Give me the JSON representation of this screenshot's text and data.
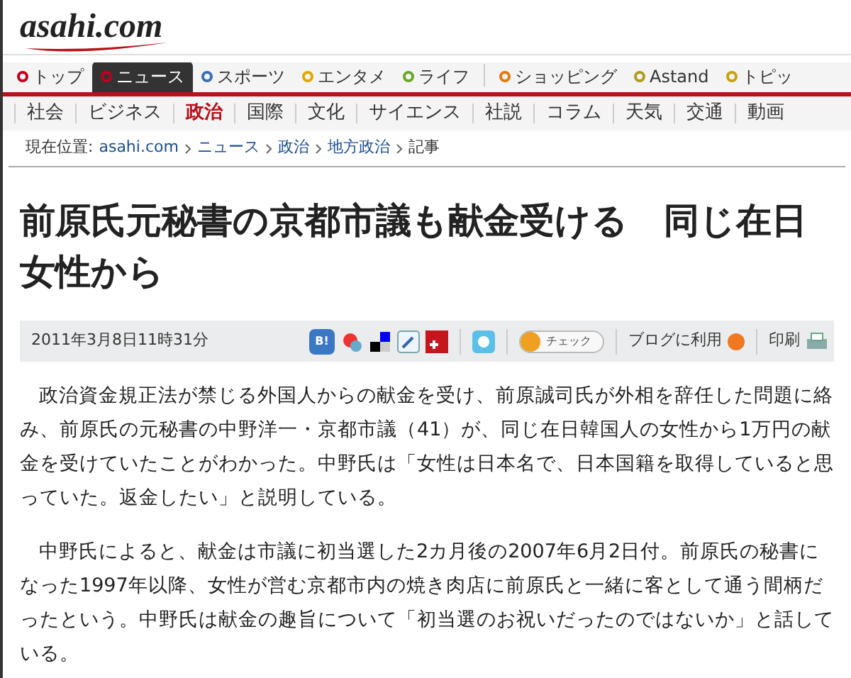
{
  "logo": "asahi.com",
  "top_nav": [
    {
      "label": "トップ",
      "color": "#c0001a",
      "selected": false
    },
    {
      "label": "ニュース",
      "color": "#c0001a",
      "selected": true
    },
    {
      "label": "スポーツ",
      "color": "#3a6fb0",
      "selected": false
    },
    {
      "label": "エンタメ",
      "color": "#e0a800",
      "selected": false
    },
    {
      "label": "ライフ",
      "color": "#6aa82a",
      "selected": false
    },
    {
      "label": "ショッピング",
      "color": "#e07a10",
      "selected": false
    },
    {
      "label": "Astand",
      "color": "#b09a20",
      "selected": false
    },
    {
      "label": "トピッ",
      "color": "#c8a010",
      "selected": false
    }
  ],
  "sub_nav": [
    {
      "label": "社会",
      "selected": false
    },
    {
      "label": "ビジネス",
      "selected": false
    },
    {
      "label": "政治",
      "selected": true
    },
    {
      "label": "国際",
      "selected": false
    },
    {
      "label": "文化",
      "selected": false
    },
    {
      "label": "サイエンス",
      "selected": false
    },
    {
      "label": "社説",
      "selected": false
    },
    {
      "label": "コラム",
      "selected": false
    },
    {
      "label": "天気",
      "selected": false
    },
    {
      "label": "交通",
      "selected": false
    },
    {
      "label": "動画",
      "selected": false
    }
  ],
  "breadcrumb": {
    "label": "現在位置:",
    "links": [
      "asahi.com",
      "ニュース",
      "政治",
      "地方政治"
    ],
    "current": "記事"
  },
  "headline": "前原氏元秘書の京都市議も献金受ける　同じ在日女性から",
  "toolbar": {
    "date": "2011年3月8日11時31分",
    "bookmark": "B!",
    "check": "チェック",
    "blog": "ブログに利用",
    "print": "印刷"
  },
  "paragraphs": [
    "政治資金規正法が禁じる外国人からの献金を受け、前原誠司氏が外相を辞任した問題に絡み、前原氏の元秘書の中野洋一・京都市議（41）が、同じ在日韓国人の女性から1万円の献金を受けていたことがわかった。中野氏は「女性は日本名で、日本国籍を取得していると思っていた。返金したい」と説明している。",
    "中野氏によると、献金は市議に初当選した2カ月後の2007年6月2日付。前原氏の秘書になった1997年以降、女性が営む京都市内の焼き肉店に前原氏と一緒に客として通う間柄だったという。中野氏は献金の趣旨について「初当選のお祝いだったのではないか」と話している。"
  ]
}
